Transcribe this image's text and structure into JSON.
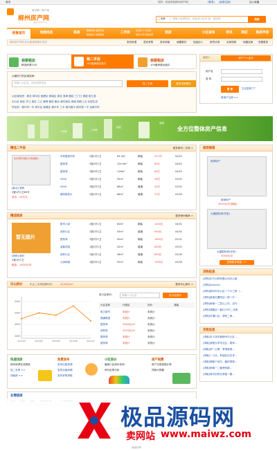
{
  "topbar": {
    "home": "首页",
    "welcome": "您好，欢迎来到柳州房产网！",
    "login": "[登录]",
    "register": "[免费注册]",
    "bookmark": "加入收藏"
  },
  "logo": {
    "slogan": "柳州第一房产网",
    "name": "柳州房产网",
    "url": "www.lzfcw.com"
  },
  "search": {
    "type": "二手房",
    "placeholder": "请输入房源特征，地址或小区名 如：银洲苑",
    "button": "搜索"
  },
  "nav": {
    "items": [
      "租售首页",
      "地图找房",
      "新房",
      "二手房",
      "租房",
      "小区查询",
      "资讯",
      "网店",
      "购房手册"
    ],
    "sub_newhouse": [
      "团购特惠",
      "品牌开发",
      "楼盘热点",
      "优质楼盘"
    ],
    "sub_second": [
      "全景房",
      "个人房源",
      "经纪公司",
      "优质房源"
    ]
  },
  "subnav": {
    "notice": "柳州房产网与五大家房网携手发布",
    "links": [
      "发布房源",
      "发布求购",
      "发布求租",
      "我要委托",
      "找经纪人",
      "房贷计算",
      "买房测算",
      "地图找房",
      "查看更多"
    ]
  },
  "quick": [
    {
      "title": "我要租房",
      "sub": "精选房源10头"
    },
    {
      "title": "我二手房",
      "sub": "263套房源出售中"
    },
    {
      "title": "我要租房",
      "sub": "109套房源出租中"
    }
  ],
  "school_search": {
    "label": "从最热门的区域找房：",
    "placeholder": "可输入小区名、地址或学校名",
    "button": "找二手房",
    "map_button": "更多找房服务",
    "area_rows": [
      "从区域找房：柳北 城中区 鱼峰区 柳南区 柳北 洛埠 雒容 三门江 柳城 柳江县",
      "中心区 柳北 环江 新区 三江 鹿寨 融安 融水 柳东新区 柳南 阳和工业 北部生态",
      "学区房：柳州市一中 城中区 鱼峰区 柳州市 三中 柳州高中 柳州铁一中 龙城中学"
    ]
  },
  "login_box": {
    "title": "房产个人会员",
    "tab": "经纪人",
    "user_label": "用户名",
    "pass_label": "密 码",
    "button": "登 录",
    "forgot": "忘记密码了？",
    "register": "新用户注册 >>"
  },
  "banner": {
    "text": "全方位整体房产信息",
    "words": [
      "一手房",
      "二手房",
      "经纪",
      "装修"
    ]
  },
  "second_hand": {
    "title": "精选二手房",
    "more": "更多柳州二手房 >",
    "photo_caption": "此房源暂无图片已添加图片",
    "featured_name": "[柳北] 银桥",
    "featured_meta": "3室1厅1卫69平",
    "featured_price": "总价：43万元",
    "rows": [
      [
        "华邦嘉禧华府",
        "2室1厅1卫",
        "65.5m²",
        "精装",
        "43.5万",
        "04/01"
      ],
      [
        "银桥湾",
        "3室2厅1卫",
        "104.9m²",
        "精装",
        "65万",
        "04/01"
      ],
      [
        "银桥湾",
        "3室2厅1卫",
        "118m²",
        "精装",
        "69万",
        "04/01"
      ],
      [
        "5656",
        "2室1厅1卫",
        "55m²",
        "精装",
        "26万",
        "03/31"
      ],
      [
        "5656",
        "3室2厅2卫",
        "88m²",
        "普通",
        "40万",
        "03/31"
      ],
      [
        "建材新苑大",
        "2室1厅1卫",
        "68m²",
        "普通",
        "31万",
        "03/30"
      ]
    ]
  },
  "rental": {
    "title": "精选租房",
    "more": "更多柳州租房 >",
    "photo_caption": "暂无图片",
    "featured_name": "[阳和] 新村",
    "featured_meta": "2室1厅1卫",
    "featured_price": "租金：1400元/月",
    "rows": [
      [
        "都市人家",
        "2室1厅1卫",
        "60m²",
        "精装",
        "1400元",
        "04/01"
      ],
      [
        "西林小区",
        "2室1厅1卫",
        "55m²",
        "普通",
        "900元",
        "04/01"
      ],
      [
        "银桥湾",
        "3室2厅1卫",
        "90m²",
        "精装",
        "1800元",
        "03/31"
      ],
      [
        "金都花园",
        "1室1厅1卫",
        "42m²",
        "普通",
        "650元",
        "03/31"
      ],
      [
        "西林小区",
        "2室1厅1卫",
        "58m²",
        "普通",
        "850元",
        "03/30"
      ],
      [
        "九洲和锦",
        "3室2厅1卫",
        "92m²",
        "精装",
        "1500元",
        "03/30"
      ]
    ]
  },
  "featured_estate": {
    "title": "推荐楼盘",
    "items": [
      {
        "name": "新城地产",
        "caption": "新城地产",
        "price": "4553元/平(精装)"
      },
      {
        "name": "大唐国际城(在售)",
        "caption": "大唐国际城(在售)",
        "price": "3004元/平"
      }
    ],
    "more": "查看更多楼盘 >>"
  },
  "price_trend": {
    "title": "乐山房价",
    "subtitle": "乐山二手房挂牌均价：",
    "avg": "4149元/m²",
    "more": "更多乐山房价 >",
    "search_label": "查小区房价：",
    "search_placeholder": "请输入小区名",
    "search_button": "查小区房价",
    "table_header": [
      "小区名称",
      "行政区",
      "均价",
      "涨幅"
    ],
    "table_rows": [
      [
        "电力新村",
        "未统计",
        "未统计"
      ],
      [
        "国通家园",
        "未统计",
        "未统计"
      ],
      [
        "银桥湾",
        "3464元/m²",
        "未统计"
      ],
      [
        "西林苑",
        "4553元/m²",
        "未统计"
      ],
      [
        "银桥湾",
        "未统计",
        "未统计"
      ],
      [
        "银桥湾",
        "未统计",
        "未统计"
      ]
    ]
  },
  "chart_data": {
    "type": "line",
    "categories": [
      "201103",
      "201104",
      "201105",
      "201106",
      "201107"
    ],
    "values": [
      4750,
      5000,
      4900,
      5300,
      4650
    ],
    "ylabel": "",
    "yticks": [
      4000,
      4500,
      5000,
      5500
    ],
    "ylim": [
      3900,
      5700
    ],
    "color": "#ff7a00",
    "grid": true
  },
  "requests": {
    "buy_title": "求购信息",
    "rent_title": "求租信息",
    "buy_rows": [
      "[求购]东方大院有限公司办公室",
      "[求购]dsdsdsd",
      "[求购]柳州市中心区一个小三房（...",
      "[求购]某某位置附近一房一厅...",
      "[求购]柳南一二层以上内，出行...",
      "[求购]想要买一套约70平二手房",
      "[求购]东環小区，求购二房..."
    ],
    "rent_rows": [
      "[求租]本人找东都柳州中心区 ...",
      "[求租]我是大学毕业生，刚来...",
      "[求租]求一公寓，有带家具...",
      "[求租]一人住，有朋友住在本...",
      "[求租]想租个地方，最好带家...",
      "[求租]柳南一二套房转租...",
      "[求租]城中区附近求租一套..."
    ]
  },
  "bottom_tiles": [
    {
      "title": "快速找房",
      "lines": [
        "柳州房源在线搜索",
        "找二手房 >>",
        "找租房 >>"
      ]
    },
    {
      "title": "免费发布",
      "lines": [
        "发布出售房源",
        "发布出租房源",
        "发布求购求租"
      ]
    },
    {
      "title": "小区房价",
      "lines": [
        "最新小区房价查询",
        "房价走势分析"
      ]
    },
    {
      "title": "房产税费",
      "lines": [
        "房产交易税费计算",
        "贷款计算器"
      ]
    }
  ],
  "links": {
    "title": "友情链接",
    "items": [
      "百度",
      "新浪",
      "搜狐",
      "柳州房产网",
      "乐山房产网"
    ]
  },
  "watermark": {
    "title": "极品源码网",
    "sub": "卖网站",
    "url": "www.maiwz.com"
  },
  "footer": {
    "text": "版权所有",
    "about": "关于我们 | 联系我们 | 网站地图"
  }
}
